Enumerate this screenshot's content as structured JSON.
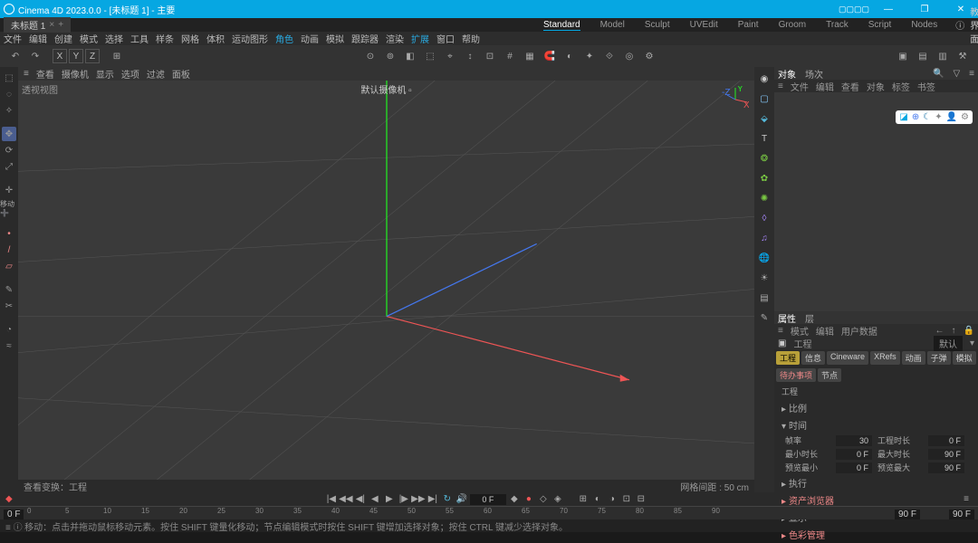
{
  "titlebar": {
    "text": "Cinema 4D 2023.0.0 - [未标题 1] - 主要"
  },
  "doc_tab": {
    "name": "未标题 1",
    "close": "×"
  },
  "workspaces": [
    "Standard",
    "Model",
    "Sculpt",
    "UVEdit",
    "Paint",
    "Groom",
    "Track",
    "Script",
    "Nodes"
  ],
  "workspace_active": 0,
  "layout_label": "教界面",
  "menubar": [
    "文件",
    "编辑",
    "创建",
    "模式",
    "选择",
    "工具",
    "样条",
    "网格",
    "体积",
    "运动图形",
    "角色",
    "动画",
    "模拟",
    "跟踪器",
    "渲染",
    "扩展",
    "窗口",
    "帮助"
  ],
  "menubar_hl": [
    10,
    15
  ],
  "axes": [
    "X",
    "Y",
    "Z"
  ],
  "viewbar": {
    "menu": "≡",
    "items": [
      "查看",
      "摄像机",
      "显示",
      "选项",
      "过滤",
      "面板"
    ]
  },
  "viewport": {
    "label": "透视视图",
    "camera": "默认摄像机 ▫",
    "grid": "网格间距 : 50 cm",
    "status_left": "查看变换：工程"
  },
  "obj_panel": {
    "tabs": [
      "对象",
      "场次"
    ],
    "sub": [
      "≡",
      "文件",
      "编辑",
      "查看",
      "对象",
      "标签",
      "书签"
    ]
  },
  "attr_panel": {
    "tabs": [
      "属性",
      "层"
    ],
    "sub": [
      "≡",
      "模式",
      "编辑",
      "用户数据"
    ],
    "modelabel": "默认",
    "title": "工程",
    "main_tabs": [
      "工程",
      "信息",
      "Cineware",
      "XRefs",
      "动画",
      "子弹",
      "模拟"
    ],
    "extra_tabs": [
      "待办事项",
      "节点"
    ],
    "section_title": "工程",
    "sections": [
      "比例",
      "时间",
      "执行",
      "资产浏览器",
      "显示",
      "色彩管理"
    ],
    "time_rows": [
      {
        "l1": "帧率",
        "v1": "30",
        "l2": "工程时长",
        "v2": "0 F"
      },
      {
        "l1": "最小时长",
        "v1": "0 F",
        "l2": "最大时长",
        "v2": "90 F"
      },
      {
        "l1": "预览最小",
        "v1": "0 F",
        "l2": "预览最大",
        "v2": "90 F"
      }
    ]
  },
  "movetool_label": "移动 ➕",
  "timeline": {
    "frame": "0 F",
    "start": "0 F",
    "end": "90 F",
    "ticks": [
      "0",
      "5",
      "10",
      "15",
      "20",
      "25",
      "30",
      "35",
      "40",
      "45",
      "50",
      "55",
      "60",
      "65",
      "70",
      "75",
      "80",
      "85",
      "90"
    ]
  },
  "statusbar": "移动：点击并拖动鼠标移动元素。按住 SHIFT 键量化移动；节点编辑模式时按住 SHIFT 键增加选择对象；按住 CTRL 键减少选择对象。"
}
